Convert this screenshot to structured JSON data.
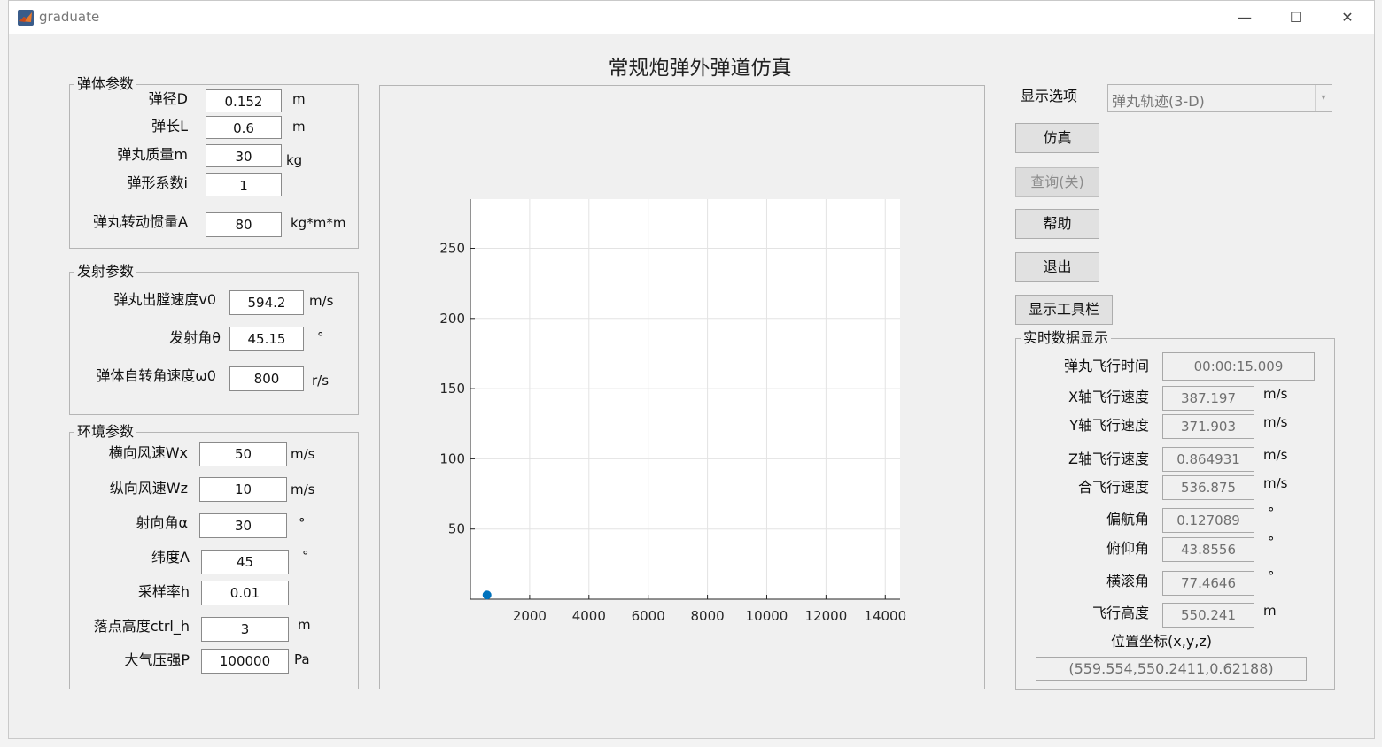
{
  "window": {
    "title": "graduate",
    "controls": {
      "minimize": "—",
      "maximize": "☐",
      "close": "✕"
    }
  },
  "main_title": "常规炮弹外弹道仿真",
  "body_params": {
    "title": "弹体参数",
    "fields": [
      {
        "label": "弹径D",
        "value": "0.152",
        "unit": "m"
      },
      {
        "label": "弹长L",
        "value": "0.6",
        "unit": "m"
      },
      {
        "label": "弹丸质量m",
        "value": "30",
        "unit": "kg"
      },
      {
        "label": "弹形系数i",
        "value": "1",
        "unit": ""
      },
      {
        "label": "弹丸转动惯量A",
        "value": "80",
        "unit": "kg*m*m"
      }
    ]
  },
  "launch_params": {
    "title": "发射参数",
    "fields": [
      {
        "label": "弹丸出膛速度v0",
        "value": "594.2",
        "unit": "m/s"
      },
      {
        "label": "发射角θ",
        "value": "45.15",
        "unit": "°"
      },
      {
        "label": "弹体自转角速度ω0",
        "value": "800",
        "unit": "r/s"
      }
    ]
  },
  "env_params": {
    "title": "环境参数",
    "fields": [
      {
        "label": "横向风速Wx",
        "value": "50",
        "unit": "m/s"
      },
      {
        "label": "纵向风速Wz",
        "value": "10",
        "unit": "m/s"
      },
      {
        "label": "射向角α",
        "value": "30",
        "unit": "°"
      },
      {
        "label": "纬度Λ",
        "value": "45",
        "unit": "°"
      },
      {
        "label": "采样率h",
        "value": "0.01",
        "unit": ""
      },
      {
        "label": "落点高度ctrl_h",
        "value": "3",
        "unit": "m"
      },
      {
        "label": "大气压强P",
        "value": "100000",
        "unit": "Pa"
      }
    ]
  },
  "display_option": {
    "label": "显示选项",
    "selected": "弹丸轨迹(3-D)"
  },
  "buttons": {
    "simulate": "仿真",
    "query": "查询(关)",
    "help": "帮助",
    "exit": "退出",
    "toolbar": "显示工具栏"
  },
  "realtime": {
    "title": "实时数据显示",
    "fields": [
      {
        "label": "弹丸飞行时间",
        "value": "00:00:15.009",
        "unit": ""
      },
      {
        "label": "X轴飞行速度",
        "value": "387.197",
        "unit": "m/s"
      },
      {
        "label": "Y轴飞行速度",
        "value": "371.903",
        "unit": "m/s"
      },
      {
        "label": "Z轴飞行速度",
        "value": "0.864931",
        "unit": "m/s"
      },
      {
        "label": "合飞行速度",
        "value": "536.875",
        "unit": "m/s"
      },
      {
        "label": "偏航角",
        "value": "0.127089",
        "unit": "°"
      },
      {
        "label": "俯仰角",
        "value": "43.8556",
        "unit": "°"
      },
      {
        "label": "横滚角",
        "value": "77.4646",
        "unit": "°"
      },
      {
        "label": "飞行高度",
        "value": "550.241",
        "unit": "m"
      }
    ],
    "position_label": "位置坐标(x,y,z)",
    "position_value": "(559.554,550.2411,0.62188)"
  },
  "chart_data": {
    "type": "scatter",
    "title": "",
    "xlabel": "",
    "ylabel": "",
    "xlim": [
      0,
      14500
    ],
    "ylim": [
      0,
      285
    ],
    "x_ticks": [
      2000,
      4000,
      6000,
      8000,
      10000,
      12000,
      14000
    ],
    "y_ticks": [
      50,
      100,
      150,
      200,
      250
    ],
    "grid": true,
    "series": [
      {
        "x": [
          560
        ],
        "y": [
          3
        ],
        "color": "#0072bd"
      }
    ]
  }
}
